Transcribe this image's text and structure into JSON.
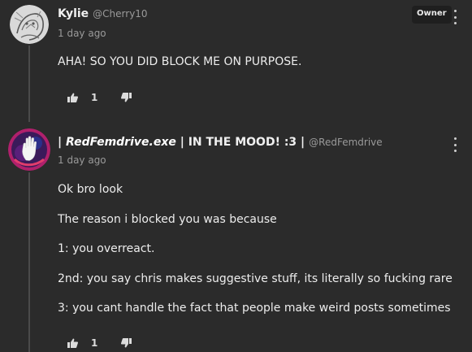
{
  "comments": [
    {
      "author": "Kylie",
      "handle": "@Cherry10",
      "time": "1 day ago",
      "badge": "Owner",
      "avatar_icon": "sketch-avatar-icon",
      "paragraphs": [
        "AHA! SO YOU DID BLOCK ME ON PURPOSE."
      ],
      "likes": "1"
    },
    {
      "author_prefix": "| ",
      "author_emphasis": "RedFemdrive.exe",
      "author_suffix": " | IN THE MOOD! :3 |",
      "handle": "@RedFemdrive",
      "time": "1 day ago",
      "avatar_icon": "raised-hand-avatar-icon",
      "paragraphs": [
        "Ok bro look",
        "The reason i blocked you was because",
        "1: you overreact.",
        "2nd: you say chris makes suggestive stuff, its literally so fucking rare",
        "3: you cant handle the fact that people make weird posts sometimes"
      ],
      "likes": "1"
    }
  ],
  "colors": {
    "background": "#2b2b2b",
    "thread_line": "#4a4a4a",
    "text": "#ededed",
    "muted": "#9a9a9a",
    "badge_bg": "#1f1f1f",
    "avatar2_ring": "#b0206c"
  },
  "icons": {
    "like": "thumbs-up-icon",
    "dislike": "thumbs-down-icon",
    "more": "more-options-icon"
  }
}
